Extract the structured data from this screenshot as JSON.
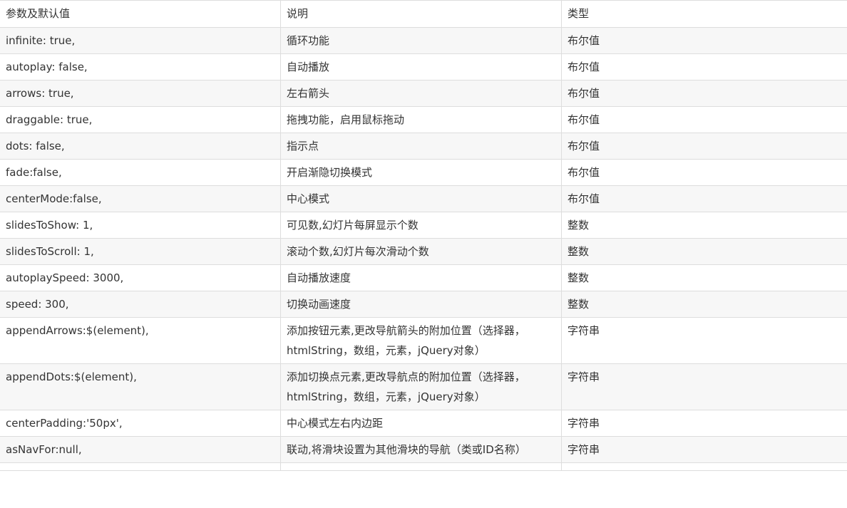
{
  "table": {
    "headers": [
      "参数及默认值",
      "说明",
      "类型"
    ],
    "rows": [
      {
        "param": "infinite: true,",
        "desc": "循环功能",
        "type": "布尔值"
      },
      {
        "param": "autoplay: false,",
        "desc": "自动播放",
        "type": "布尔值"
      },
      {
        "param": "arrows: true,",
        "desc": "左右箭头",
        "type": "布尔值"
      },
      {
        "param": "draggable: true,",
        "desc": "拖拽功能，启用鼠标拖动",
        "type": "布尔值"
      },
      {
        "param": "dots: false,",
        "desc": "指示点",
        "type": "布尔值"
      },
      {
        "param": "fade:false,",
        "desc": "开启渐隐切换模式",
        "type": "布尔值"
      },
      {
        "param": "centerMode:false,",
        "desc": "中心模式",
        "type": "布尔值"
      },
      {
        "param": "slidesToShow: 1,",
        "desc": "可见数,幻灯片每屏显示个数",
        "type": "整数"
      },
      {
        "param": "slidesToScroll: 1,",
        "desc": "滚动个数,幻灯片每次滑动个数",
        "type": "整数"
      },
      {
        "param": "autoplaySpeed: 3000,",
        "desc": "自动播放速度",
        "type": "整数"
      },
      {
        "param": "speed: 300,",
        "desc": "切换动画速度",
        "type": "整数"
      },
      {
        "param": "appendArrows:$(element),",
        "desc": "添加按钮元素,更改导航箭头的附加位置（选择器，htmlString，数组，元素，jQuery对象）",
        "type": "字符串"
      },
      {
        "param": "appendDots:$(element),",
        "desc": "添加切换点元素,更改导航点的附加位置（选择器，htmlString，数组，元素，jQuery对象）",
        "type": "字符串"
      },
      {
        "param": "centerPadding:'50px',",
        "desc": "中心模式左右内边距",
        "type": "字符串"
      },
      {
        "param": "asNavFor:null,",
        "desc": "联动,将滑块设置为其他滑块的导航（类或ID名称）",
        "type": "字符串"
      }
    ]
  }
}
